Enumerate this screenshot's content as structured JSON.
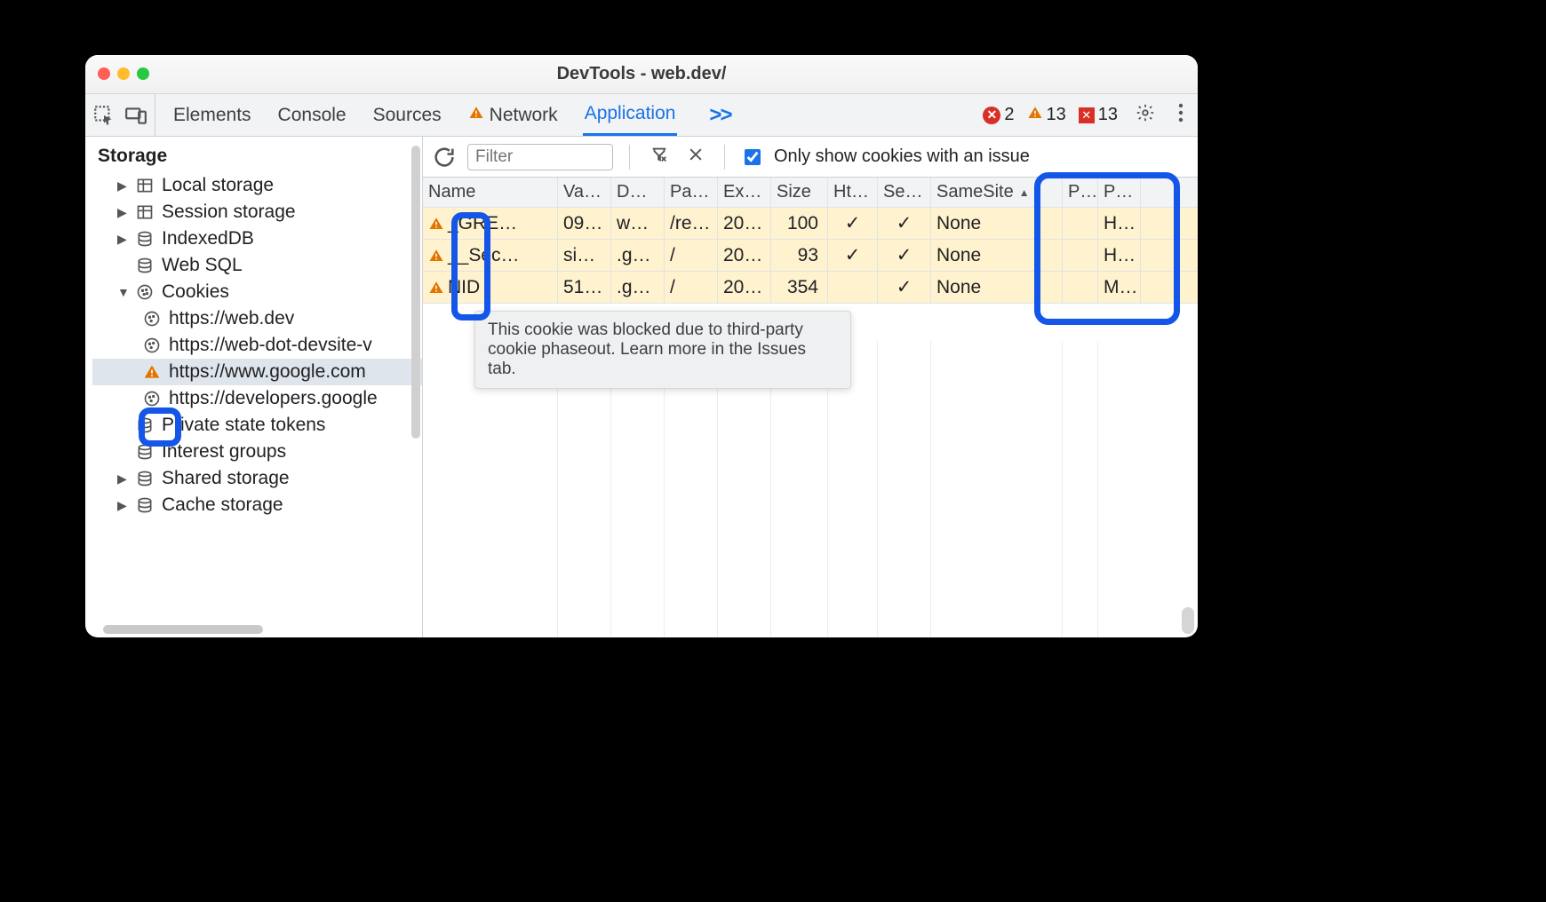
{
  "window": {
    "title": "DevTools - web.dev/"
  },
  "tabs": {
    "elements": "Elements",
    "console": "Console",
    "sources": "Sources",
    "network": "Network",
    "application": "Application",
    "more": ">>"
  },
  "status": {
    "errors": "2",
    "warnings": "13",
    "messages": "13"
  },
  "sidebar": {
    "section": "Storage",
    "items": {
      "local": "Local storage",
      "session": "Session storage",
      "indexed": "IndexedDB",
      "websql": "Web SQL",
      "cookies": "Cookies",
      "cookies_children": {
        "c0": "https://web.dev",
        "c1": "https://web-dot-devsite-v",
        "c2": "https://www.google.com",
        "c3": "https://developers.google"
      },
      "pst": "Private state tokens",
      "interest": "Interest groups",
      "shared": "Shared storage",
      "cache": "Cache storage"
    }
  },
  "toolbar": {
    "filter_placeholder": "Filter",
    "only_issue": "Only show cookies with an issue"
  },
  "columns": {
    "name": "Name",
    "value": "Va…",
    "domain": "D…",
    "path": "Pa…",
    "expires": "Ex…",
    "size": "Size",
    "http": "Ht…",
    "secure": "Se…",
    "samesite": "SameSite",
    "part": "P…",
    "priority": "P…"
  },
  "rows": [
    {
      "name": "_GRE…",
      "value": "09…",
      "domain": "w…",
      "path": "/re…",
      "expires": "20…",
      "size": "100",
      "http": "✓",
      "secure": "✓",
      "samesite": "None",
      "part": "",
      "priority": "H…"
    },
    {
      "name": "__Sec…",
      "value": "si…",
      "domain": ".g…",
      "path": "/",
      "expires": "20…",
      "size": "93",
      "http": "✓",
      "secure": "✓",
      "samesite": "None",
      "part": "",
      "priority": "H…"
    },
    {
      "name": "NID",
      "value": "51…",
      "domain": ".g…",
      "path": "/",
      "expires": "20…",
      "size": "354",
      "http": "",
      "secure": "✓",
      "samesite": "None",
      "part": "",
      "priority": "M…"
    }
  ],
  "tooltip": "This cookie was blocked due to third-party cookie phaseout. Learn more in the Issues tab."
}
